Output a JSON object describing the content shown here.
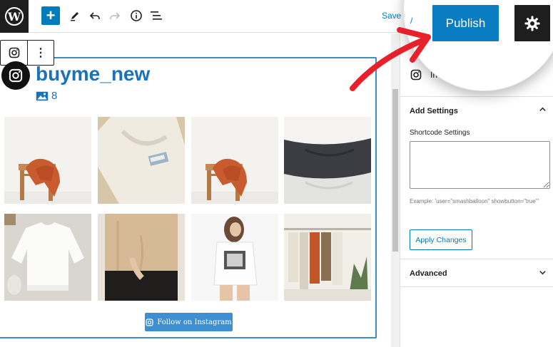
{
  "toolbar": {
    "save_draft": "Save dra",
    "save_draft_magnified": "/",
    "publish_label": "Publish"
  },
  "block": {
    "username": "buyme_new",
    "image_count": "8",
    "follow_label": "Follow on Instagram"
  },
  "sidebar": {
    "block_name_partial": "In",
    "add_settings_title": "Add Settings",
    "shortcode_label": "Shortcode Settings",
    "shortcode_value": "",
    "example_text": "Example: 'user=\"smashballoon\" showbutton=\"true\"'",
    "apply_label": "Apply Changes",
    "advanced_title": "Advanced"
  },
  "icons": {
    "wordpress": "wordpress-logo-icon",
    "add": "plus-icon",
    "edit": "pencil-icon",
    "undo": "undo-icon",
    "redo": "redo-icon",
    "info": "info-icon",
    "list": "list-view-icon",
    "instagram": "instagram-icon",
    "more": "more-vertical-icon",
    "gear": "gear-icon",
    "close": "close-icon"
  },
  "colors": {
    "accent": "#007cba",
    "publish": "#0a7cc1",
    "username": "#1a73b8",
    "follow_button": "#3d8fd1",
    "arrow": "#e8202a"
  },
  "gallery": [
    {
      "name": "orange-sweater-on-chair"
    },
    {
      "name": "cream-sweater-with-tag"
    },
    {
      "name": "orange-sweater-on-chair-2"
    },
    {
      "name": "grey-knit-sweaters"
    },
    {
      "name": "white-sweatshirt-flatlay"
    },
    {
      "name": "beige-sweater-person"
    },
    {
      "name": "woman-printed-tshirt"
    },
    {
      "name": "clothing-rack"
    }
  ]
}
